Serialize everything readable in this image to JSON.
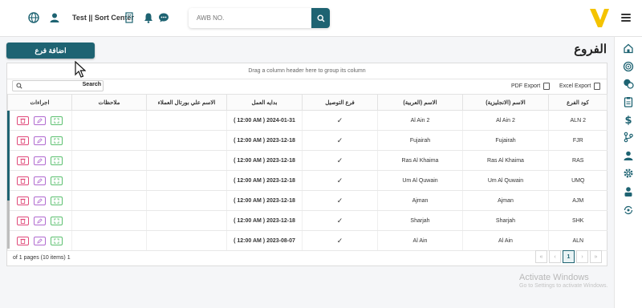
{
  "topbar": {
    "user_label": "Test || Sort Center",
    "search_placeholder": "AWB NO."
  },
  "page": {
    "title": "الفروع",
    "add_button": "اضافة فرع"
  },
  "grid": {
    "group_hint": "Drag a column header here to group its column",
    "search_button": "Search",
    "search_value": "",
    "pdf_export": "PDF Export",
    "excel_export": "Excel Export",
    "columns": [
      "اجراءات",
      "ملاحظات",
      "الاسم علي بورتال العملاء",
      "بدايه العمل",
      "فرع التوصيل",
      "الاسم (العربية)",
      "الاسم (الانجليزية)",
      "كود الفرع"
    ],
    "rows": [
      {
        "notes": "",
        "portal_name": "",
        "start": "( 12:00 AM ) 2024-01-31",
        "delivery": "✓",
        "name_ar": "Al Ain 2",
        "name_en": "Al Ain 2",
        "code": "ALN 2"
      },
      {
        "notes": "",
        "portal_name": "",
        "start": "( 12:00 AM ) 2023-12-18",
        "delivery": "✓",
        "name_ar": "Fujairah",
        "name_en": "Fujairah",
        "code": "FJR"
      },
      {
        "notes": "",
        "portal_name": "",
        "start": "( 12:00 AM ) 2023-12-18",
        "delivery": "✓",
        "name_ar": "Ras Al Khaima",
        "name_en": "Ras Al Khaima",
        "code": "RAS"
      },
      {
        "notes": "",
        "portal_name": "",
        "start": "( 12:00 AM ) 2023-12-18",
        "delivery": "✓",
        "name_ar": "Um Al Quwain",
        "name_en": "Um Al Quwain",
        "code": "UMQ"
      },
      {
        "notes": "",
        "portal_name": "",
        "start": "( 12:00 AM ) 2023-12-18",
        "delivery": "✓",
        "name_ar": "Ajman",
        "name_en": "Ajman",
        "code": "AJM"
      },
      {
        "notes": "",
        "portal_name": "",
        "start": "( 12:00 AM ) 2023-12-18",
        "delivery": "✓",
        "name_ar": "Sharjah",
        "name_en": "Sharjah",
        "code": "SHK"
      },
      {
        "notes": "",
        "portal_name": "",
        "start": "( 12:00 AM ) 2023-08-07",
        "delivery": "✓",
        "name_ar": "Al Ain",
        "name_en": "Al Ain",
        "code": "ALN"
      }
    ],
    "pager_info": "of 1 pages (10 items) 1",
    "pages": [
      "«",
      "‹",
      "1",
      "›",
      "»"
    ],
    "current_page": "1"
  },
  "watermark": {
    "title": "Activate Windows",
    "subtitle": "Go to Settings to activate Windows."
  },
  "colors": {
    "primary": "#1e6372",
    "logo_yellow": "#f4c300",
    "delete": "#e04a7a",
    "edit": "#b06ad0",
    "view": "#5cc070"
  }
}
